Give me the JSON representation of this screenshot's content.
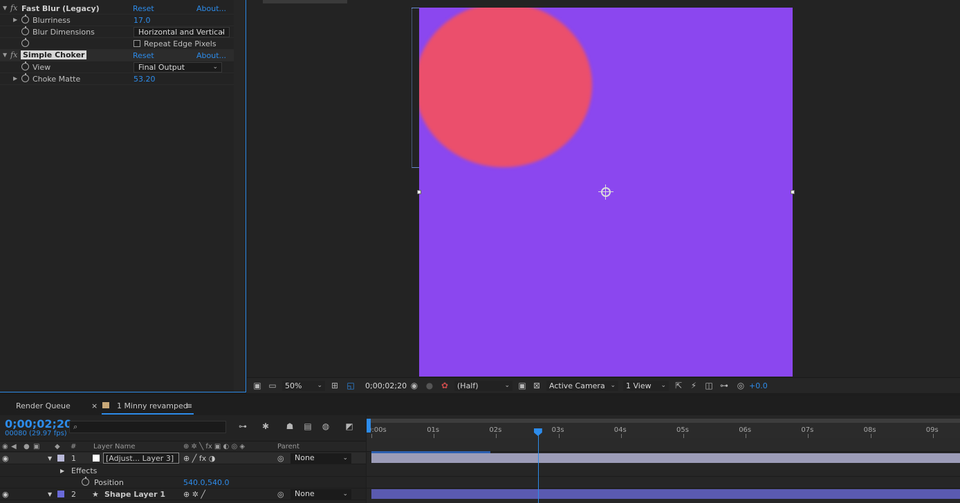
{
  "effect_controls": {
    "effects": [
      {
        "name": "Fast Blur (Legacy)",
        "reset": "Reset",
        "about": "About...",
        "params": [
          {
            "label": "Blurriness",
            "value": "17.0"
          },
          {
            "label": "Blur Dimensions",
            "dropdown": "Horizontal and Vertical"
          },
          {
            "checkbox_label": "Repeat Edge Pixels",
            "checked": false
          }
        ]
      },
      {
        "name": "Simple Choker",
        "reset": "Reset",
        "about": "About...",
        "params": [
          {
            "label": "View",
            "dropdown": "Final Output"
          },
          {
            "label": "Choke Matte",
            "value": "53.20"
          }
        ]
      }
    ]
  },
  "viewer": {
    "canvas_color": "#8b47ef",
    "circle_color": "#eb4f6c",
    "toolbar": {
      "zoom": "50%",
      "timecode": "0;00;02;20",
      "resolution": "(Half)",
      "camera": "Active Camera",
      "views": "1 View",
      "exposure": "+0.0"
    }
  },
  "timeline": {
    "tabs": {
      "render_queue": "Render Queue",
      "close": "×",
      "comp": "1 Minny revamped",
      "menu": "≡"
    },
    "timecode": "0;00;02;20",
    "frame_info": "00080 (29.97 fps)",
    "search_placeholder": "",
    "headers": {
      "num": "#",
      "layer_name": "Layer Name",
      "parent": "Parent"
    },
    "layers": [
      {
        "num": "1",
        "name": "[Adjust... Layer 3]",
        "parent": "None",
        "color": "#b8b8d8"
      },
      {
        "effects_label": "Effects"
      },
      {
        "prop": "Position",
        "value": "540.0,540.0"
      },
      {
        "num": "2",
        "name": "Shape Layer 1",
        "parent": "None",
        "color": "#6a6ad8"
      }
    ],
    "ruler": [
      "0:00s",
      "01s",
      "02s",
      "03s",
      "04s",
      "05s",
      "06s",
      "07s",
      "08s",
      "09s"
    ],
    "current_time_seconds": 2.67
  }
}
